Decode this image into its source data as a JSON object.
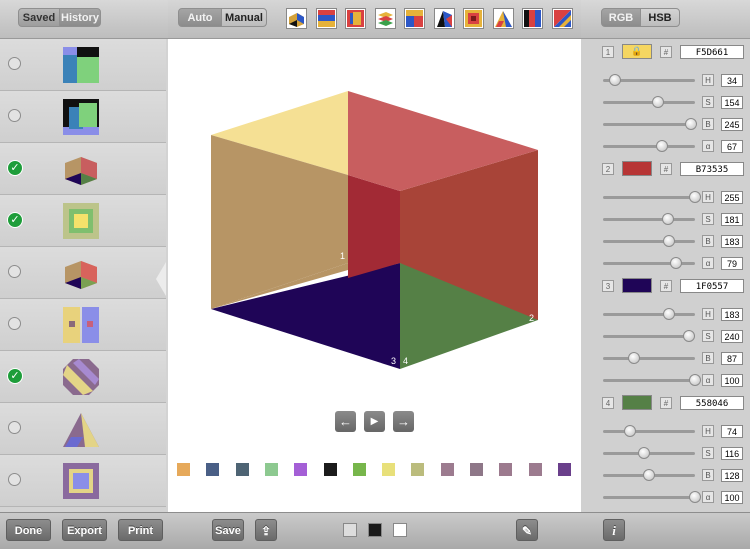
{
  "left_panel": {
    "tabs": [
      "Saved",
      "History"
    ],
    "active_tab": "Saved",
    "rows": [
      {
        "checked": false,
        "thumb": "thumb-1"
      },
      {
        "checked": false,
        "thumb": "thumb-2"
      },
      {
        "checked": true,
        "thumb": "thumb-3"
      },
      {
        "checked": true,
        "thumb": "thumb-4"
      },
      {
        "checked": false,
        "thumb": "thumb-5"
      },
      {
        "checked": false,
        "thumb": "thumb-6"
      },
      {
        "checked": true,
        "thumb": "thumb-7"
      },
      {
        "checked": false,
        "thumb": "thumb-8"
      },
      {
        "checked": false,
        "thumb": "thumb-9"
      }
    ],
    "buttons": {
      "done": "Done",
      "export": "Export",
      "print": "Print"
    }
  },
  "toolbar": {
    "mode_tabs": [
      "Auto",
      "Manual"
    ],
    "active_mode": "Manual",
    "presets": [
      "cube-preset",
      "stripes-preset",
      "nested-squares-preset",
      "layers-preset",
      "blocks-preset",
      "fold-preset",
      "frame-preset",
      "triangle-preset",
      "bars-preset",
      "diagonal-preset"
    ]
  },
  "canvas": {
    "corner_labels": [
      "1",
      "2",
      "3",
      "4"
    ],
    "nav": {
      "prev": "←",
      "play": "▶",
      "next": "→"
    },
    "palette": [
      "#E6A95A",
      "#4A5F86",
      "#4E6474",
      "#8DC990",
      "#A45FD6",
      "#1B1B1B",
      "#77B64B",
      "#E8E07A",
      "#BBBC7D",
      "#9C7B8F",
      "#8E7788",
      "#9C7A8E",
      "#9C7B8F",
      "#6A3F8B"
    ]
  },
  "bottom_center": {
    "save": "Save",
    "share_icon": "share-icon",
    "bg_options": [
      "#DDDDDD",
      "#1A1A1A",
      "#FFFFFF"
    ],
    "eyedropper_icon": "eyedropper-icon"
  },
  "right_panel": {
    "tabs": [
      "RGB",
      "HSB"
    ],
    "active_tab": "HSB",
    "hash": "#",
    "colors": [
      {
        "index": "1",
        "swatch": "#F5D661",
        "hex": "F5D661",
        "locked": true,
        "channels": [
          {
            "label": "H",
            "value": "34",
            "level": 0.13
          },
          {
            "label": "S",
            "value": "154",
            "level": 0.6
          },
          {
            "label": "B",
            "value": "245",
            "level": 0.96
          },
          {
            "label": "α",
            "value": "67",
            "level": 0.64
          }
        ]
      },
      {
        "index": "2",
        "swatch": "#B73535",
        "hex": "B73535",
        "locked": false,
        "channels": [
          {
            "label": "H",
            "value": "255",
            "level": 1.0
          },
          {
            "label": "S",
            "value": "181",
            "level": 0.71
          },
          {
            "label": "B",
            "value": "183",
            "level": 0.72
          },
          {
            "label": "α",
            "value": "79",
            "level": 0.79
          }
        ]
      },
      {
        "index": "3",
        "swatch": "#1F0557",
        "hex": "1F0557",
        "locked": false,
        "channels": [
          {
            "label": "H",
            "value": "183",
            "level": 0.72
          },
          {
            "label": "S",
            "value": "240",
            "level": 0.94
          },
          {
            "label": "B",
            "value": "87",
            "level": 0.34
          },
          {
            "label": "α",
            "value": "100",
            "level": 1.0
          }
        ]
      },
      {
        "index": "4",
        "swatch": "#558046",
        "hex": "558046",
        "locked": false,
        "channels": [
          {
            "label": "H",
            "value": "74",
            "level": 0.29
          },
          {
            "label": "S",
            "value": "116",
            "level": 0.45
          },
          {
            "label": "B",
            "value": "128",
            "level": 0.5
          },
          {
            "label": "α",
            "value": "100",
            "level": 1.0
          }
        ]
      }
    ],
    "info_icon": "i"
  }
}
